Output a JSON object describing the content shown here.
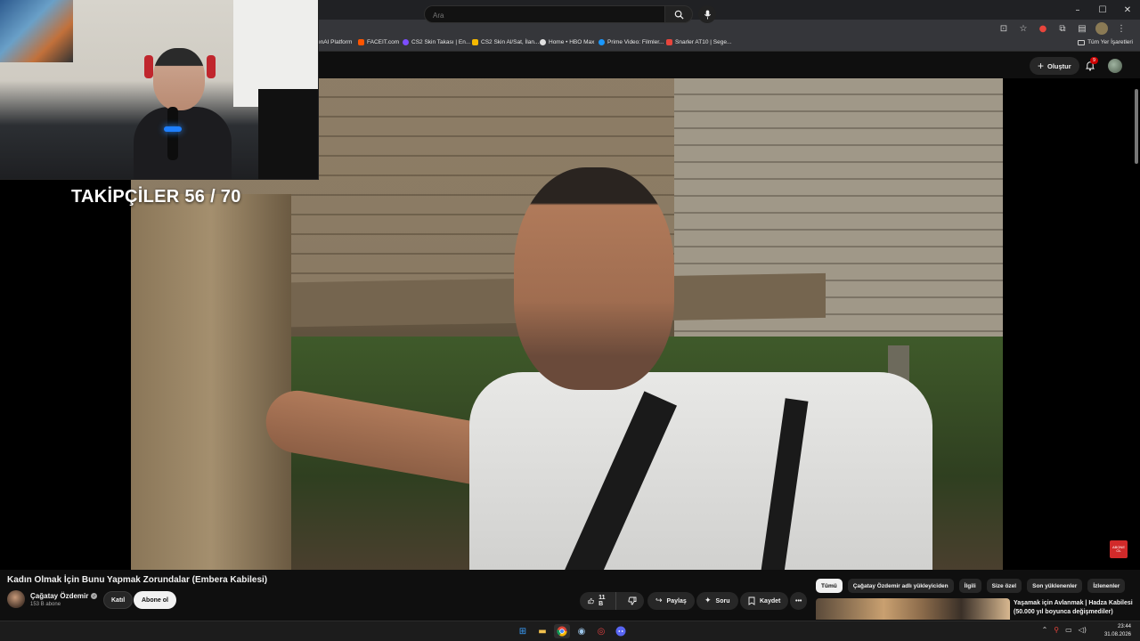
{
  "browser": {
    "window_controls": {
      "minimize": "–",
      "maximize": "☐",
      "close": "✕"
    },
    "toolbar_icons": [
      "install-icon",
      "star-icon",
      "extension-red-icon",
      "extensions-icon",
      "sidepanel-icon",
      "profile-icon",
      "menu-icon"
    ],
    "bookmarks": [
      {
        "label": "enAI Platform",
        "color": "#9aa0a6"
      },
      {
        "label": "FACEIT.com",
        "color": "#ff5500"
      },
      {
        "label": "CS2 Skin Takası | En...",
        "color": "#7c4dff"
      },
      {
        "label": "CS2 Skin Al/Sat, İlan...",
        "color": "#f5b800"
      },
      {
        "label": "Home • HBO Max",
        "color": "#e0e0e0"
      },
      {
        "label": "Prime Video: Filmler...",
        "color": "#1a98ff"
      },
      {
        "label": "Snarler AT10 | Sege...",
        "color": "#e8453c"
      }
    ],
    "all_bookmarks": "Tüm Yer İşaretleri"
  },
  "youtube": {
    "search_placeholder": "Ara",
    "create_label": "Oluştur",
    "notification_count": "9",
    "accent": "#cc0000"
  },
  "stream_overlay": {
    "followers_text": "TAKİPÇİLER 56 / 70",
    "watermark_line1": "ABONE",
    "watermark_line2": "OL"
  },
  "video": {
    "title": "Kadın Olmak İçin Bunu Yapmak Zorundalar (Embera Kabilesi)",
    "channel_name": "Çağatay Özdemir",
    "subscribers": "153 B abone",
    "join_label": "Katıl",
    "subscribe_label": "Abone ol",
    "likes": "11 B",
    "share_label": "Paylaş",
    "ask_label": "Soru",
    "save_label": "Kaydet",
    "more_label": "•••"
  },
  "recommendations": {
    "chips": [
      "Tümü",
      "Çağatay Özdemir adlı yükleyiciden",
      "İlgili",
      "Size özel",
      "Son yüklenenler",
      "İzlenenler"
    ],
    "first_title": "Yaşamak için Avlanmak | Hadza Kabilesi (50.000 yıl boyunca değişmediler)"
  },
  "taskbar": {
    "time": "23:44",
    "date": "31.08.2026"
  }
}
